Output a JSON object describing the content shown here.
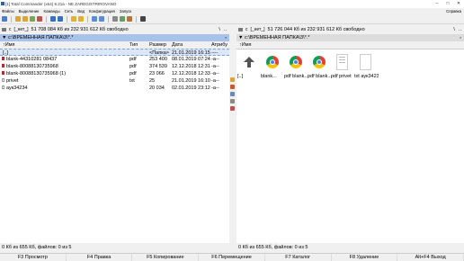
{
  "window": {
    "title": "[1] Total Commander (x64) 9.21a - NE ZAREGISTRIROVANO",
    "controls": [
      "–",
      "□",
      "✕"
    ]
  },
  "menu": {
    "items": [
      "Файлы",
      "Выделение",
      "Команды",
      "Сеть",
      "Вид",
      "Конфигурация",
      "Запуск"
    ],
    "right": "Справка"
  },
  "left": {
    "drive": "c",
    "drive_label": "[_нет_]",
    "free_info": "51 708 084 Кб из 232 931 612 Кб свободно",
    "nav_back": "\\",
    "nav_up": "..",
    "path": "▼ c:\\ВРЕМЕННАЯ ПАПКА\\3\\*.*",
    "history": "*",
    "columns": {
      "name": "↑Имя",
      "ext": "Тип",
      "size": "Размер",
      "date": "Дата",
      "attr": "Атрибу"
    },
    "rows": [
      {
        "name": "[..]",
        "ext": "",
        "size": "<Папка>",
        "date": "21.01.2019 16:15",
        "attr": "----"
      },
      {
        "name": "blank-44310281 08437",
        "ext": "pdf",
        "size": "253 400",
        "date": "08.01.2019 07:24",
        "attr": "-a--"
      },
      {
        "name": "blank-80088130735968",
        "ext": "pdf",
        "size": "374 539",
        "date": "12.12.2018 12:31",
        "attr": "-a--"
      },
      {
        "name": "blank-80088130735968 (1)",
        "ext": "pdf",
        "size": "23 066",
        "date": "12.12.2018 12:33",
        "attr": "-a--"
      },
      {
        "name": "privet",
        "ext": "txt",
        "size": "25",
        "date": "21.01.2019 16:10",
        "attr": "-a--"
      },
      {
        "name": "аук34234",
        "ext": "",
        "size": "20 034",
        "date": "02.01.2019 23:12",
        "attr": "-a--"
      }
    ],
    "status": "0 Кб из 655 Кб, файлов: 0 из 5"
  },
  "right": {
    "drive": "c",
    "drive_label": "[_нет_]",
    "free_info": "51 726 044 Кб из 232 931 612 Кб свободно",
    "nav_back": "\\",
    "nav_up": "..",
    "path": "▼ c:\\ВРЕМЕННАЯ ПАПКА\\3\\*.*",
    "history": "*",
    "columns": {
      "name": "↑Имя"
    },
    "thumbs": [
      {
        "label": "[..]",
        "icon": "up-folder-icon"
      },
      {
        "label": "blank...",
        "icon": "chrome-pdf-icon"
      },
      {
        "label": "pdf blank...",
        "icon": "chrome-pdf-icon"
      },
      {
        "label": "pdf blank...",
        "icon": "chrome-pdf-icon"
      },
      {
        "label": "pdf privet",
        "icon": "text-file-icon"
      },
      {
        "label": "txt аук34234",
        "icon": "blank-file-icon"
      }
    ],
    "status": "0 Кб из 655 Кб, файлов: 0 из 5"
  },
  "fkeys": [
    "F3 Просмотр",
    "F4 Правка",
    "F5 Копирование",
    "F6 Перемещение",
    "F7 Каталог",
    "F8 Удаление",
    "Alt+F4 Выход"
  ],
  "colors": {
    "active_path": "#a8c2ea",
    "cursor_row": "#dbe6f7",
    "chrome_blue": "#4285f4"
  }
}
